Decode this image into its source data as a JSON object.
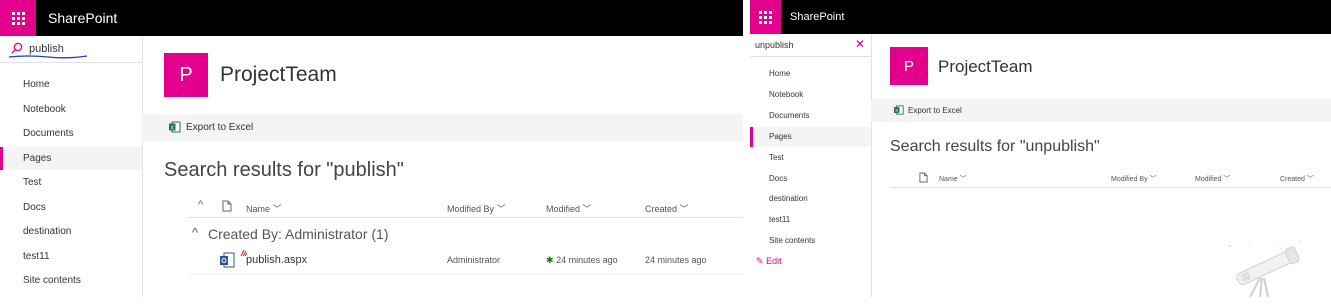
{
  "left": {
    "brand": "SharePoint",
    "search_value": "publish",
    "nav": [
      "Home",
      "Notebook",
      "Documents",
      "Pages",
      "Test",
      "Docs",
      "destination",
      "test11",
      "Site contents"
    ],
    "selected_nav": "Pages",
    "site_initial": "P",
    "site_title": "ProjectTeam",
    "export_label": "Export to Excel",
    "results_title": "Search results for \"publish\"",
    "columns": {
      "name": "Name",
      "modified_by": "Modified By",
      "modified": "Modified",
      "created": "Created"
    },
    "group_label": "Created By: Administrator (1)",
    "row": {
      "name": "publish.aspx",
      "modified_by": "Administrator",
      "modified": "24 minutes ago",
      "created": "24 minutes ago"
    }
  },
  "right": {
    "brand": "SharePoint",
    "search_value": "unpublish",
    "nav": [
      "Home",
      "Notebook",
      "Documents",
      "Pages",
      "Test",
      "Docs",
      "destination",
      "test11",
      "Site contents"
    ],
    "selected_nav": "Pages",
    "edit_label": "Edit",
    "site_initial": "P",
    "site_title": "ProjectTeam",
    "export_label": "Export to Excel",
    "results_title": "Search results for \"unpublish\"",
    "columns": {
      "name": "Name",
      "modified_by": "Modified By",
      "modified": "Modified",
      "created": "Created"
    }
  },
  "colors": {
    "accent": "#e3008c",
    "topbar": "#000000",
    "excel": "#217346"
  }
}
